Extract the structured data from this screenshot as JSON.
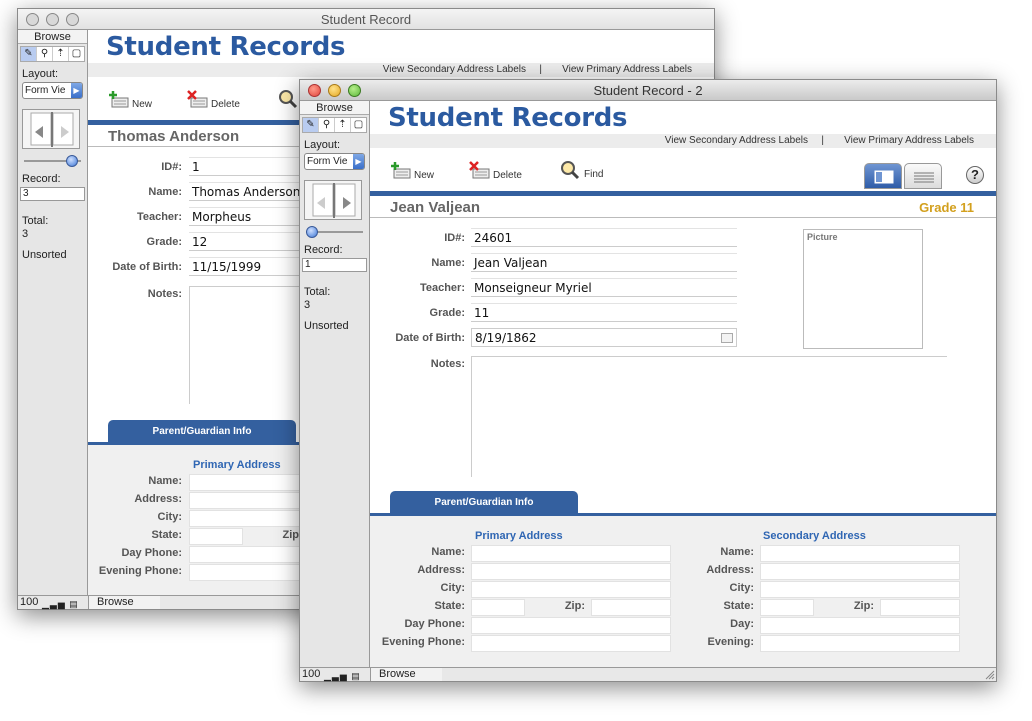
{
  "back_window": {
    "title": "Student Record",
    "sidebar": {
      "mode": "Browse",
      "tools": [
        "✎",
        "⚲",
        "⇡",
        "▢"
      ],
      "layout_label": "Layout:",
      "layout_value": "Form Vie",
      "record_label": "Record:",
      "record_value": "3",
      "total_label": "Total:",
      "total_value": "3",
      "sort_status": "Unsorted"
    },
    "status": {
      "zoom": "100",
      "mode": "Browse"
    },
    "header": {
      "title": "Student Records",
      "link_secondary": "View Secondary Address Labels",
      "separator": "|",
      "link_primary": "View Primary Address Labels"
    },
    "toolbar": {
      "new_label": "New",
      "delete_label": "Delete"
    },
    "record": {
      "name_heading": "Thomas Anderson",
      "id_label": "ID#:",
      "id_value": "1",
      "name_label": "Name:",
      "name_value": "Thomas Anderson",
      "teacher_label": "Teacher:",
      "teacher_value": "Morpheus",
      "grade_label": "Grade:",
      "grade_value": "12",
      "dob_label": "Date of Birth:",
      "dob_value": "11/15/1999",
      "notes_label": "Notes:"
    },
    "parent_tab": "Parent/Guardian Info",
    "primary_address": {
      "heading": "Primary Address",
      "name_label": "Name:",
      "address_label": "Address:",
      "city_label": "City:",
      "state_label": "State:",
      "zip_label": "Zip",
      "day_phone_label": "Day Phone:",
      "evening_phone_label": "Evening Phone:"
    }
  },
  "front_window": {
    "title": "Student Record - 2",
    "sidebar": {
      "mode": "Browse",
      "tools": [
        "✎",
        "⚲",
        "⇡",
        "▢"
      ],
      "layout_label": "Layout:",
      "layout_value": "Form Vie",
      "record_label": "Record:",
      "record_value": "1",
      "total_label": "Total:",
      "total_value": "3",
      "sort_status": "Unsorted"
    },
    "status": {
      "zoom": "100",
      "mode": "Browse"
    },
    "header": {
      "title": "Student Records",
      "link_secondary": "View Secondary Address Labels",
      "separator": "|",
      "link_primary": "View Primary Address Labels"
    },
    "toolbar": {
      "new_label": "New",
      "delete_label": "Delete",
      "find_label": "Find",
      "help_label": "?"
    },
    "record": {
      "name_heading": "Jean Valjean",
      "grade_heading": "Grade 11",
      "id_label": "ID#:",
      "id_value": "24601",
      "name_label": "Name:",
      "name_value": "Jean Valjean",
      "teacher_label": "Teacher:",
      "teacher_value": "Monseigneur Myriel",
      "grade_label": "Grade:",
      "grade_value": "11",
      "dob_label": "Date of Birth:",
      "dob_value": "8/19/1862",
      "notes_label": "Notes:",
      "picture_label": "Picture"
    },
    "parent_tab": "Parent/Guardian Info",
    "primary_address": {
      "heading": "Primary Address",
      "name_label": "Name:",
      "address_label": "Address:",
      "city_label": "City:",
      "state_label": "State:",
      "zip_label": "Zip:",
      "day_phone_label": "Day Phone:",
      "evening_phone_label": "Evening Phone:"
    },
    "secondary_address": {
      "heading": "Secondary Address",
      "name_label": "Name:",
      "address_label": "Address:",
      "city_label": "City:",
      "state_label": "State:",
      "zip_label": "Zip:",
      "day_label": "Day:",
      "evening_label": "Evening:"
    }
  },
  "colors": {
    "accent": "#34609f",
    "title_blue": "#2b5aa0",
    "grade_gold": "#d3a01e"
  }
}
